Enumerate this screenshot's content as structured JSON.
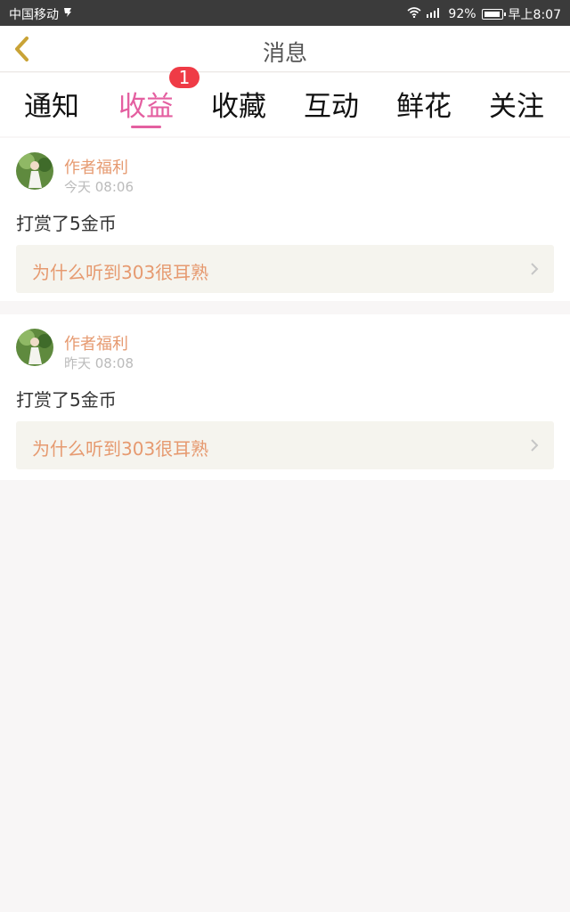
{
  "status": {
    "carrier": "中国移动",
    "signal_label": "2G",
    "battery": "92%",
    "time": "早上8:07"
  },
  "header": {
    "back_icon": "back-chevron-icon",
    "title": "消息"
  },
  "tabs": [
    {
      "label": "通知"
    },
    {
      "label": "收益",
      "active": true,
      "badge": "1"
    },
    {
      "label": "收藏"
    },
    {
      "label": "互动"
    },
    {
      "label": "鲜花"
    },
    {
      "label": "关注"
    }
  ],
  "messages": [
    {
      "author": "作者福利",
      "time": "今天 08:06",
      "action": "打赏了5金币",
      "link": "为什么听到303很耳熟"
    },
    {
      "author": "作者福利",
      "time": "昨天 08:08",
      "action": "打赏了5金币",
      "link": "为什么听到303很耳熟"
    }
  ],
  "colors": {
    "accent": "#e45fa0",
    "badge": "#ef3b46",
    "author": "#e69a70"
  }
}
